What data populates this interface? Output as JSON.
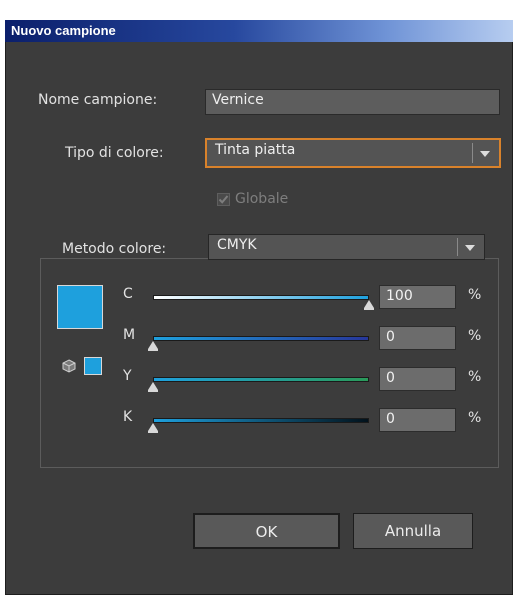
{
  "window": {
    "title": "Nuovo campione"
  },
  "form": {
    "name_label": "Nome campione:",
    "name_value": "Vernice",
    "color_type_label": "Tipo di colore:",
    "color_type_value": "Tinta piatta",
    "global_label": "Globale",
    "global_checked": true,
    "global_enabled": false
  },
  "color_mode": {
    "label": "Metodo colore:",
    "value": "CMYK"
  },
  "swatch": {
    "color": "#1ea0dd"
  },
  "channels": [
    {
      "label": "C",
      "value": "100",
      "unit": "%",
      "fraction": 1.0,
      "gradient_end": "#1ea0dd",
      "gradient_start": "#ffffff"
    },
    {
      "label": "M",
      "value": "0",
      "unit": "%",
      "fraction": 0.0,
      "gradient_end": "#27379a",
      "gradient_start": "#1ea0dd"
    },
    {
      "label": "Y",
      "value": "0",
      "unit": "%",
      "fraction": 0.0,
      "gradient_end": "#2a9a5a",
      "gradient_start": "#1ea0dd"
    },
    {
      "label": "K",
      "value": "0",
      "unit": "%",
      "fraction": 0.0,
      "gradient_end": "#02121c",
      "gradient_start": "#1ea0dd"
    }
  ],
  "buttons": {
    "ok": "OK",
    "cancel": "Annulla"
  }
}
